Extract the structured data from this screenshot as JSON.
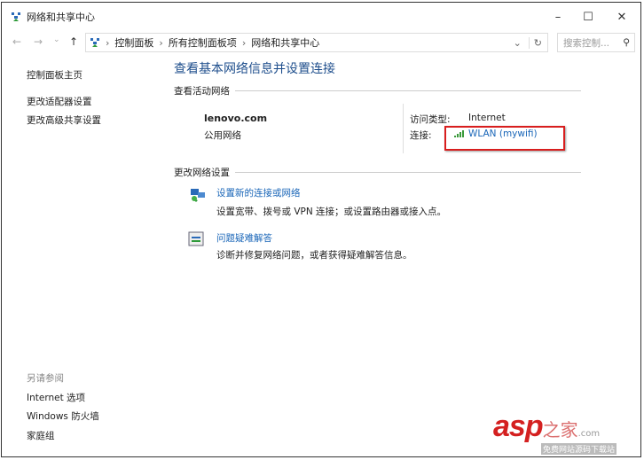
{
  "window": {
    "title": "网络和共享中心",
    "minimize": "–",
    "maximize": "☐",
    "close": "✕"
  },
  "address": {
    "back": "←",
    "forward": "→",
    "recent": "⌄",
    "up": "↑",
    "crumbs": [
      "控制面板",
      "所有控制面板项",
      "网络和共享中心"
    ],
    "separator": "›",
    "dropdown": "⌄",
    "refresh": "↻",
    "search_placeholder": "搜索控制...",
    "search_icon": "⚲"
  },
  "sidebar": {
    "items": [
      "控制面板主页",
      "更改适配器设置",
      "更改高级共享设置"
    ],
    "see_also_title": "另请参阅",
    "see_also": [
      "Internet 选项",
      "Windows 防火墙",
      "家庭组"
    ]
  },
  "main": {
    "title": "查看基本网络信息并设置连接",
    "active_section": "查看活动网络",
    "network_name": "lenovo.com",
    "network_type": "公用网络",
    "access_label": "访问类型:",
    "access_value": "Internet",
    "conn_label": "连接:",
    "conn_value": "WLAN (mywifi)",
    "change_section": "更改网络设置",
    "tasks": [
      {
        "title": "设置新的连接或网络",
        "desc": "设置宽带、拨号或 VPN 连接；或设置路由器或接入点。"
      },
      {
        "title": "问题疑难解答",
        "desc": "诊断并修复网络问题，或者获得疑难解答信息。"
      }
    ]
  },
  "watermark": {
    "brand": "asp",
    "brand2": "之家",
    "domain": ".com",
    "tagline": "免费网站源码下载站"
  },
  "colors": {
    "link": "#1a66b8",
    "title": "#1e4e8c",
    "highlight": "#d81e1e"
  }
}
